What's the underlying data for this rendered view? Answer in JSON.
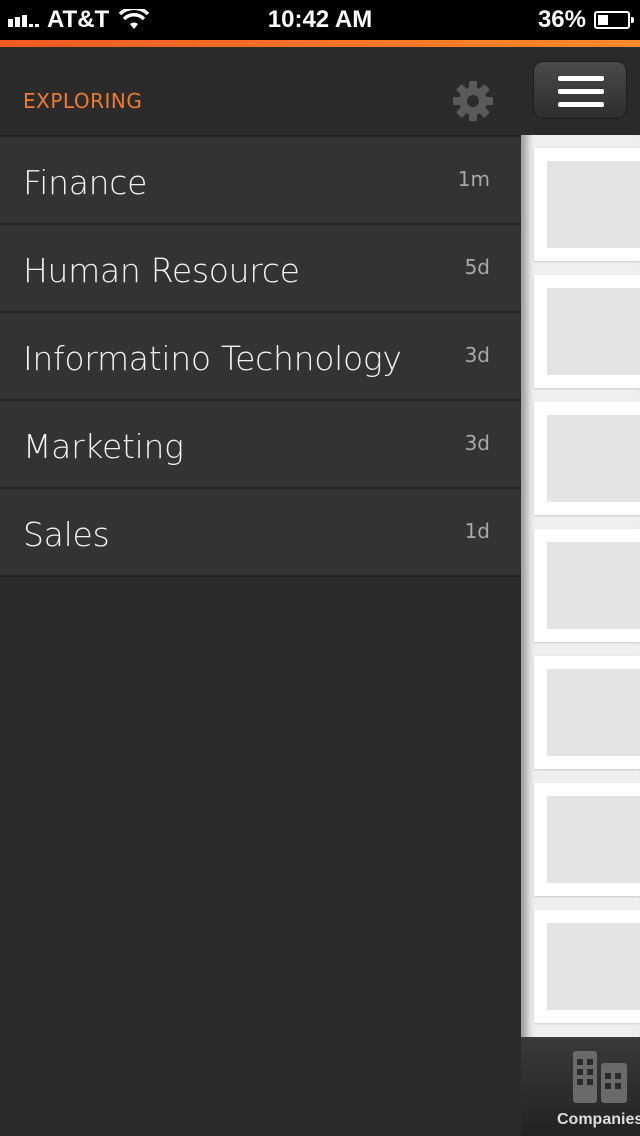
{
  "status_bar": {
    "carrier": "AT&T",
    "time": "10:42 AM",
    "battery": "36%",
    "battery_level": 0.36
  },
  "drawer": {
    "title": "EXPLORING",
    "settings_icon": "gear-icon",
    "items": [
      {
        "label": "Finance",
        "time": "1m"
      },
      {
        "label": "Human Resource",
        "time": "5d"
      },
      {
        "label": "Informatino Technology",
        "time": "3d"
      },
      {
        "label": "Marketing",
        "time": "3d"
      },
      {
        "label": "Sales",
        "time": "1d"
      }
    ]
  },
  "main": {
    "menu_icon": "hamburger-icon",
    "tab_bar": {
      "tabs": [
        {
          "label": "Companies",
          "icon": "buildings-icon"
        }
      ]
    }
  },
  "colors": {
    "accent": "#f07a2b",
    "drawer_bg": "#2b2b2b",
    "item_bg": "#333333"
  }
}
